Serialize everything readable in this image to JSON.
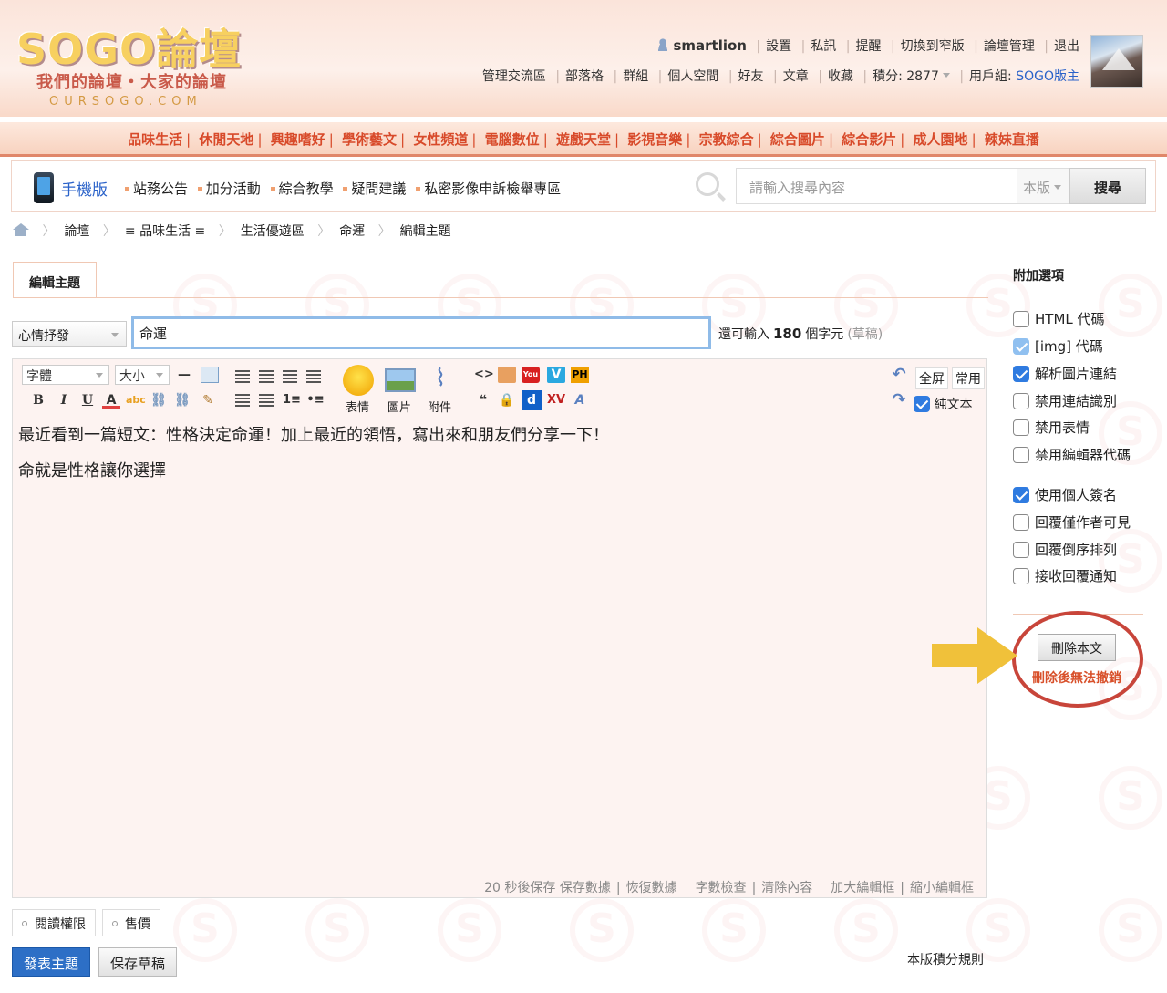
{
  "logo": {
    "text": "SOGO論壇",
    "subtitle": "我們的論壇・大家的論壇",
    "domain": "OURSOGO.COM"
  },
  "user_bar": {
    "username": "smartlion",
    "links": [
      "設置",
      "私訊",
      "提醒",
      "切換到窄版",
      "論壇管理",
      "退出"
    ]
  },
  "site_bar": {
    "links": [
      "管理交流區",
      "部落格",
      "群組",
      "個人空間",
      "好友",
      "文章",
      "收藏"
    ],
    "credits_label": "積分: 2877",
    "usergroup_label": "用戶組: ",
    "usergroup_value": "SOGO版主"
  },
  "categories": [
    "品味生活",
    "休閒天地",
    "興趣嗜好",
    "學術藝文",
    "女性頻道",
    "電腦數位",
    "遊戲天堂",
    "影視音樂",
    "宗教綜合",
    "綜合圖片",
    "綜合影片",
    "成人園地",
    "辣妹直播"
  ],
  "quick_bar": {
    "mobile_label": "手機版",
    "links": [
      "站務公告",
      "加分活動",
      "綜合教學",
      "疑問建議",
      "私密影像申訴檢舉專區"
    ],
    "search_placeholder": "請輸入搜尋內容",
    "search_scope": "本版",
    "search_button": "搜尋"
  },
  "breadcrumb": [
    "論壇",
    "≡ 品味生活 ≡",
    "生活優遊區",
    "命運",
    "編輯主題"
  ],
  "editor": {
    "tab_label": "編輯主題",
    "mood": "心情抒發",
    "subject": "命運",
    "remaining_prefix": "還可輸入",
    "remaining_count": "180",
    "remaining_suffix": "個字元",
    "draft_note": "(草稿)",
    "font_select": "字體",
    "size_select": "大小",
    "emoji_label": "表情",
    "image_label": "圖片",
    "attach_label": "附件",
    "fullscreen": "全屏",
    "common": "常用",
    "plain_text": "純文本",
    "plain_text_checked": true,
    "body": [
      "最近看到一篇短文：性格決定命運！加上最近的領悟，寫出來和朋友們分享一下！",
      "命就是性格讓你選擇"
    ],
    "footer_links": [
      "20 秒後保存 保存數據",
      "恢復數據",
      "字數檢查",
      "清除內容",
      "加大編輯框",
      "縮小編輯框"
    ]
  },
  "bottom": {
    "read_perm": "閱讀權限",
    "sell": "售價",
    "post_button": "發表主題",
    "save_draft_button": "保存草稿",
    "credit_rules": "本版積分規則"
  },
  "side_panel": {
    "title": "附加選項",
    "options": [
      {
        "label": "HTML 代碼",
        "state": "off"
      },
      {
        "label": "[img] 代碼",
        "state": "disabled-on"
      },
      {
        "label": "解析圖片連結",
        "state": "on"
      },
      {
        "label": "禁用連結識別",
        "state": "off"
      },
      {
        "label": "禁用表情",
        "state": "off"
      },
      {
        "label": "禁用編輯器代碼",
        "state": "off"
      },
      {
        "label": "使用個人簽名",
        "state": "on"
      },
      {
        "label": "回覆僅作者可見",
        "state": "off"
      },
      {
        "label": "回覆倒序排列",
        "state": "off"
      },
      {
        "label": "接收回覆通知",
        "state": "off"
      }
    ],
    "delete_button": "刪除本文",
    "delete_warning": "刪除後無法撤銷"
  },
  "colors": {
    "accent_blue": "#2d6fc6",
    "category_red": "#d84a2a",
    "highlight_circle": "#c8453a",
    "arrow_yellow": "#f0c13a"
  }
}
